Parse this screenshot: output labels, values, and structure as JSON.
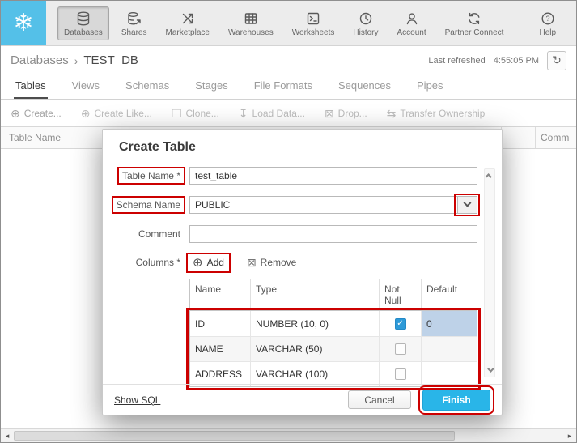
{
  "colors": {
    "accent": "#29B5E8",
    "annotation": "#CC0000",
    "logo_bg": "#54C0E8",
    "selected_cell_bg": "#BED2E8"
  },
  "icons": {
    "snowflake": "❄",
    "refresh": "↻",
    "circle_plus": "⊕",
    "clone": "❐",
    "load": "↧",
    "drop": "⊠",
    "transfer": "⇆",
    "remove": "⊠",
    "check": "✓",
    "scroll_left": "◂",
    "scroll_right": "▸"
  },
  "topnav": {
    "items": [
      {
        "label": "Databases",
        "active": true
      },
      {
        "label": "Shares",
        "active": false
      },
      {
        "label": "Marketplace",
        "active": false
      },
      {
        "label": "Warehouses",
        "active": false
      },
      {
        "label": "Worksheets",
        "active": false
      },
      {
        "label": "History",
        "active": false
      },
      {
        "label": "Account",
        "active": false
      }
    ],
    "right_items": [
      {
        "label": "Partner Connect"
      },
      {
        "label": "Help"
      }
    ]
  },
  "breadcrumb": {
    "root": "Databases",
    "separator": "›",
    "current": "TEST_DB",
    "last_refreshed_label": "Last refreshed",
    "last_refreshed_time": "4:55:05 PM"
  },
  "tabs": [
    {
      "label": "Tables",
      "active": true
    },
    {
      "label": "Views",
      "active": false
    },
    {
      "label": "Schemas",
      "active": false
    },
    {
      "label": "Stages",
      "active": false
    },
    {
      "label": "File Formats",
      "active": false
    },
    {
      "label": "Sequences",
      "active": false
    },
    {
      "label": "Pipes",
      "active": false
    }
  ],
  "toolbar": {
    "items": [
      {
        "label": "Create...",
        "icon": "⊕"
      },
      {
        "label": "Create Like...",
        "icon": "⊕"
      },
      {
        "label": "Clone...",
        "icon": "❐"
      },
      {
        "label": "Load Data...",
        "icon": "↧"
      },
      {
        "label": "Drop...",
        "icon": "⊠"
      },
      {
        "label": "Transfer Ownership",
        "icon": "⇆"
      }
    ]
  },
  "list_header": {
    "table_name": "Table Name",
    "comment": "Comm"
  },
  "modal": {
    "title": "Create Table",
    "table_name_label": "Table Name *",
    "table_name_value": "test_table",
    "schema_label": "Schema Name",
    "schema_value": "PUBLIC",
    "comment_label": "Comment",
    "comment_value": "",
    "columns_label": "Columns *",
    "add_label": "Add",
    "remove_label": "Remove",
    "col_headers": [
      "Name",
      "Type",
      "Not Null",
      "Default"
    ],
    "rows": [
      {
        "name": "ID",
        "type": "NUMBER (10, 0)",
        "not_null": true,
        "default": "0",
        "default_selected": true
      },
      {
        "name": "NAME",
        "type": "VARCHAR (50)",
        "not_null": false,
        "default": "",
        "default_selected": false
      },
      {
        "name": "ADDRESS",
        "type": "VARCHAR (100)",
        "not_null": false,
        "default": "",
        "default_selected": false
      }
    ],
    "show_sql": "Show SQL",
    "cancel": "Cancel",
    "finish": "Finish"
  }
}
